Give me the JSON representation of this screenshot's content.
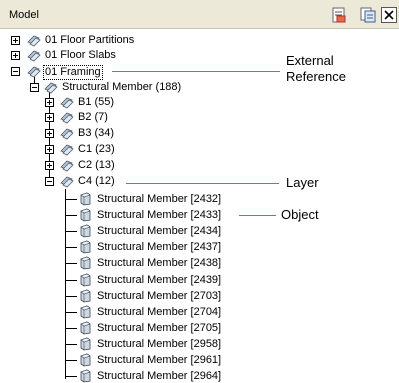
{
  "panel": {
    "title": "Model"
  },
  "toolbar": {
    "icons": [
      "properties-icon",
      "layers-icon",
      "close-icon"
    ]
  },
  "tree": {
    "top_level": [
      {
        "label": "01 Floor Partitions",
        "expanded": false
      },
      {
        "label": "01 Floor Slabs",
        "expanded": false
      },
      {
        "label": "01 Framing",
        "expanded": true
      }
    ],
    "group": {
      "label": "Structural Member (188)",
      "expanded": true
    },
    "layers": [
      {
        "label": "B1 (55)",
        "expanded": false
      },
      {
        "label": "B2 (7)",
        "expanded": false
      },
      {
        "label": "B3 (34)",
        "expanded": false
      },
      {
        "label": "C1 (23)",
        "expanded": false
      },
      {
        "label": "C2 (13)",
        "expanded": false
      },
      {
        "label": "C4 (12)",
        "expanded": true
      }
    ],
    "objects": [
      "Structural Member [2432]",
      "Structural Member [2433]",
      "Structural Member [2434]",
      "Structural Member [2437]",
      "Structural Member [2438]",
      "Structural Member [2439]",
      "Structural Member [2703]",
      "Structural Member [2704]",
      "Structural Member [2705]",
      "Structural Member [2958]",
      "Structural Member [2961]",
      "Structural Member [2964]"
    ]
  },
  "callouts": {
    "external_reference": {
      "line1": "External",
      "line2": "Reference"
    },
    "layer": "Layer",
    "object": "Object",
    "color": "#e05050"
  }
}
